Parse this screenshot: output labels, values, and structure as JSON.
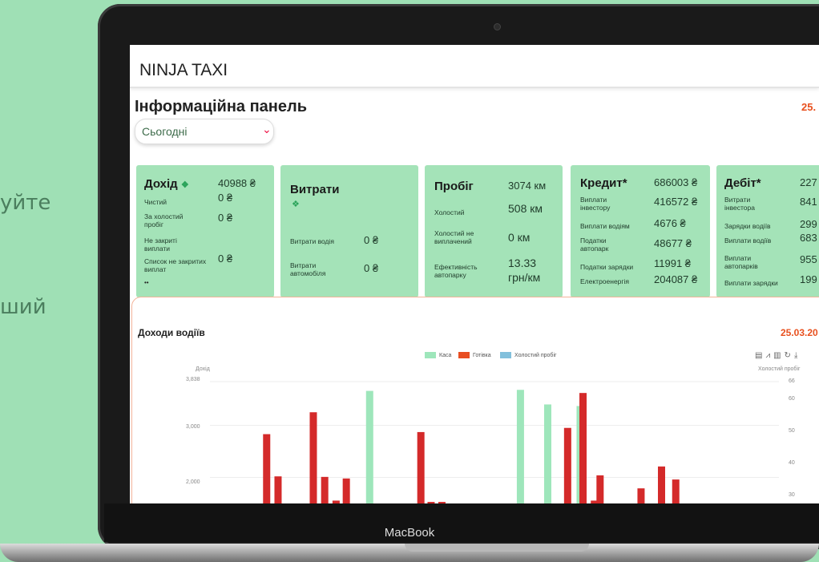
{
  "background_text": [
    "уйте",
    "ший"
  ],
  "device_label": "MacBook",
  "app": {
    "title": "NINJA TAXI"
  },
  "page": {
    "title": "Інформаційна панель",
    "date": "25.",
    "period": {
      "selected": "Сьогодні"
    }
  },
  "cards": {
    "income": {
      "title": "Дохід",
      "total": "40988 ₴",
      "rows": [
        {
          "label": "Чистий",
          "value": "0 ₴"
        },
        {
          "label": "За холостий пробіг",
          "value": "0 ₴"
        },
        {
          "label": "Не закриті виплати",
          "value": ""
        },
        {
          "label": "Список не закритих виплат",
          "value": "0 ₴"
        }
      ]
    },
    "expenses": {
      "title": "Витрати",
      "rows": [
        {
          "label": "Витрати водія",
          "value": "0 ₴"
        },
        {
          "label": "Витрати автомобіля",
          "value": "0 ₴"
        }
      ]
    },
    "mileage": {
      "title": "Пробіг",
      "total": "3074 км",
      "rows": [
        {
          "label": "Холостий",
          "value": "508 км"
        },
        {
          "label": "Холостий не виплачений",
          "value": "0 км"
        },
        {
          "label": "Ефективність автопарку",
          "value": "13.33 грн/км"
        }
      ]
    },
    "credit": {
      "title": "Кредит*",
      "total": "686003 ₴",
      "rows": [
        {
          "label": "Виплати інвестору",
          "value": "416572 ₴"
        },
        {
          "label": "Виплати водіям",
          "value": "4676 ₴"
        },
        {
          "label": "Податки автопарк",
          "value": "48677 ₴"
        },
        {
          "label": "Податки зарядки",
          "value": "11991 ₴"
        },
        {
          "label": "Електроенергія",
          "value": "204087 ₴"
        }
      ]
    },
    "debit": {
      "title": "Дебіт*",
      "total": "227",
      "rows": [
        {
          "label": "Витрати інвестора",
          "value": "841"
        },
        {
          "label": "Зарядки водіїв",
          "value": "299"
        },
        {
          "label": "Виплати водіїв",
          "value": "683"
        },
        {
          "label": "Виплати автопарків",
          "value": "955"
        },
        {
          "label": "Виплати зарядки",
          "value": "199"
        }
      ]
    }
  },
  "chart_data": {
    "type": "bar",
    "title": "Доходи водіїв",
    "date": "25.03.20",
    "ylabel": "Дохід",
    "y2label": "Холостий пробіг",
    "ylim": [
      1500,
      3838
    ],
    "yticks": [
      "3,838",
      "3,000",
      "2,000"
    ],
    "y2ticks": [
      "66",
      "60",
      "50",
      "40",
      "30"
    ],
    "series": [
      {
        "name": "Каса",
        "color": "#9ee6bb",
        "values": [
          {
            "x": 0.387,
            "v": 3660
          },
          {
            "x": 0.652,
            "v": 3680
          },
          {
            "x": 0.7,
            "v": 3400
          },
          {
            "x": 0.757,
            "v": 3370
          }
        ]
      },
      {
        "name": "Готівка",
        "color": "#d42a2a",
        "values": [
          {
            "x": 0.206,
            "v": 2830
          },
          {
            "x": 0.226,
            "v": 2020
          },
          {
            "x": 0.288,
            "v": 3250
          },
          {
            "x": 0.308,
            "v": 2010
          },
          {
            "x": 0.328,
            "v": 1555
          },
          {
            "x": 0.346,
            "v": 1980
          },
          {
            "x": 0.477,
            "v": 2870
          },
          {
            "x": 0.495,
            "v": 1530
          },
          {
            "x": 0.514,
            "v": 1530
          },
          {
            "x": 0.735,
            "v": 2950
          },
          {
            "x": 0.762,
            "v": 3620
          },
          {
            "x": 0.782,
            "v": 1555
          },
          {
            "x": 0.792,
            "v": 2040
          },
          {
            "x": 0.864,
            "v": 1790
          },
          {
            "x": 0.9,
            "v": 2210
          },
          {
            "x": 0.925,
            "v": 1960
          }
        ]
      },
      {
        "name": "Холостий пробіг",
        "color": "#82c0dc",
        "values": []
      }
    ]
  }
}
